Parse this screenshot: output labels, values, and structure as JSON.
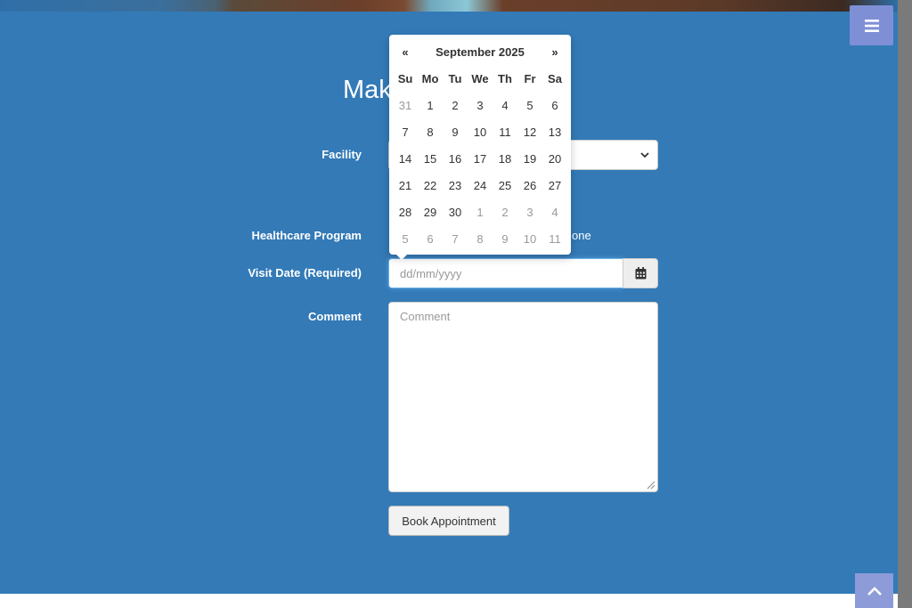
{
  "page": {
    "title": "Mak"
  },
  "form": {
    "facility_label": "Facility",
    "program_label": "Healthcare Program",
    "program_option_tail": "one",
    "visit_date_label": "Visit Date (Required)",
    "visit_date_placeholder": "dd/mm/yyyy",
    "comment_label": "Comment",
    "comment_placeholder": "Comment",
    "submit_label": "Book Appointment"
  },
  "datepicker": {
    "prev": "«",
    "next": "»",
    "month_title": "September 2025",
    "weekdays": [
      "Su",
      "Mo",
      "Tu",
      "We",
      "Th",
      "Fr",
      "Sa"
    ],
    "weeks": [
      [
        {
          "d": "31",
          "m": true
        },
        {
          "d": "1"
        },
        {
          "d": "2"
        },
        {
          "d": "3"
        },
        {
          "d": "4"
        },
        {
          "d": "5"
        },
        {
          "d": "6"
        }
      ],
      [
        {
          "d": "7"
        },
        {
          "d": "8"
        },
        {
          "d": "9"
        },
        {
          "d": "10"
        },
        {
          "d": "11"
        },
        {
          "d": "12"
        },
        {
          "d": "13"
        }
      ],
      [
        {
          "d": "14"
        },
        {
          "d": "15"
        },
        {
          "d": "16"
        },
        {
          "d": "17"
        },
        {
          "d": "18"
        },
        {
          "d": "19"
        },
        {
          "d": "20"
        }
      ],
      [
        {
          "d": "21"
        },
        {
          "d": "22"
        },
        {
          "d": "23"
        },
        {
          "d": "24"
        },
        {
          "d": "25"
        },
        {
          "d": "26"
        },
        {
          "d": "27"
        }
      ],
      [
        {
          "d": "28"
        },
        {
          "d": "29"
        },
        {
          "d": "30"
        },
        {
          "d": "1",
          "m": true
        },
        {
          "d": "2",
          "m": true
        },
        {
          "d": "3",
          "m": true
        },
        {
          "d": "4",
          "m": true
        }
      ],
      [
        {
          "d": "5",
          "m": true
        },
        {
          "d": "6",
          "m": true
        },
        {
          "d": "7",
          "m": true
        },
        {
          "d": "8",
          "m": true
        },
        {
          "d": "9",
          "m": true
        },
        {
          "d": "10",
          "m": true
        },
        {
          "d": "11",
          "m": true
        }
      ]
    ]
  },
  "colors": {
    "primary_bg": "#337ab7",
    "menu_button": "#7f8fd6",
    "focus_border": "#66afe9"
  },
  "icons": {
    "menu": "hamburger-icon",
    "calendar": "calendar-icon",
    "chevron": "chevron-down-icon",
    "scroll_top": "chevron-up-icon"
  }
}
